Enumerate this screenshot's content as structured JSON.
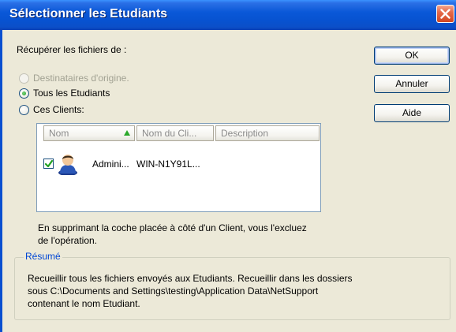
{
  "window": {
    "title": "Sélectionner les Etudiants",
    "close_glyph": "×"
  },
  "label_recover": "Récupérer les fichiers de :",
  "radios": [
    {
      "label": "Destinataires d'origine.",
      "selected": false,
      "enabled": false
    },
    {
      "label": "Tous les Etudiants",
      "selected": true,
      "enabled": true
    },
    {
      "label": "Ces Clients:",
      "selected": false,
      "enabled": true
    }
  ],
  "buttons": {
    "ok": "OK",
    "cancel": "Annuler",
    "help": "Aide"
  },
  "list": {
    "columns": [
      "Nom",
      "Nom du Cli...",
      "Description"
    ],
    "sorted_column": "Nom",
    "rows": [
      {
        "checked": true,
        "icon": "user-icon",
        "name": "Admini...",
        "client": "WIN-N1Y91L...",
        "description": ""
      }
    ]
  },
  "note_line1": "En supprimant la coche placée à côté d'un Client, vous l'excluez",
  "note_line2": "de l'opération.",
  "summary": {
    "title": "Résumé",
    "line1": "Recueillir tous les fichiers envoyés aux Etudiants. Recueillir dans les dossiers",
    "line2": "sous C:\\Documents and Settings\\testing\\Application Data\\NetSupport",
    "line3": "contenant le nom Etudiant."
  },
  "colors": {
    "titlebar": "#0752d0",
    "dialog_bg": "#ece9d8",
    "group_title": "#0046d5",
    "radio_dot": "#21a121"
  }
}
